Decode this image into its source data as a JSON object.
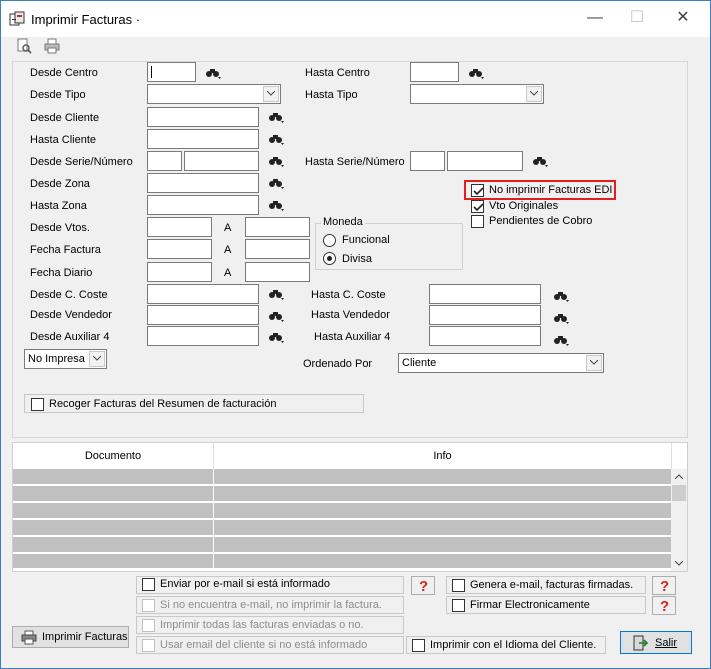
{
  "window": {
    "title": "Imprimir Facturas ·",
    "minimize": "—",
    "maximize": "☐",
    "close": "✕"
  },
  "toolbar": {
    "preview_icon": "print-preview-icon",
    "print_icon": "printer-icon"
  },
  "labels": {
    "desde_centro": "Desde Centro",
    "hasta_centro": "Hasta Centro",
    "desde_tipo": "Desde Tipo",
    "hasta_tipo": "Hasta Tipo",
    "desde_cliente": "Desde Cliente",
    "hasta_cliente": "Hasta Cliente",
    "desde_serie": "Desde Serie/Número",
    "hasta_serie": "Hasta Serie/Número",
    "desde_zona": "Desde Zona",
    "hasta_zona": "Hasta Zona",
    "desde_vtos": "Desde Vtos.",
    "fecha_factura": "Fecha Factura",
    "fecha_diario": "Fecha Diario",
    "a1": "A",
    "a2": "A",
    "a3": "A",
    "desde_coste": "Desde C. Coste",
    "hasta_coste": "Hasta C. Coste",
    "desde_vendedor": "Desde Vendedor",
    "hasta_vendedor": "Hasta Vendedor",
    "desde_aux4": "Desde Auxiliar 4",
    "hasta_aux4": "Hasta Auxiliar 4",
    "ordenado_por": "Ordenado Por"
  },
  "moneda": {
    "title": "Moneda",
    "funcional": "Funcional",
    "divisa": "Divisa",
    "selected": "Divisa"
  },
  "options": {
    "no_edi": "No imprimir Facturas EDI",
    "vto_originales": "Vto Originales",
    "pendientes": "Pendientes de Cobro",
    "recoger": "Recoger Facturas del Resumen de facturación"
  },
  "combos": {
    "impresa": "No Impresa",
    "ordenado": "Cliente"
  },
  "grid": {
    "columns": [
      "Documento",
      "Info"
    ]
  },
  "email": {
    "enviar": "Enviar por e-mail si está informado",
    "no_encuentra": "Si no encuentra e-mail, no imprimir la factura.",
    "imprimir_todas": "Imprimir todas las facturas enviadas o no.",
    "usar_email": "Usar email del cliente si no está informado",
    "genera": "Genera e-mail, facturas firmadas.",
    "firmar": "Firmar Electronicamente",
    "idioma": "Imprimir con el Idioma del Cliente."
  },
  "buttons": {
    "imprimir": "Imprimir Facturas",
    "salir": "Salir"
  }
}
